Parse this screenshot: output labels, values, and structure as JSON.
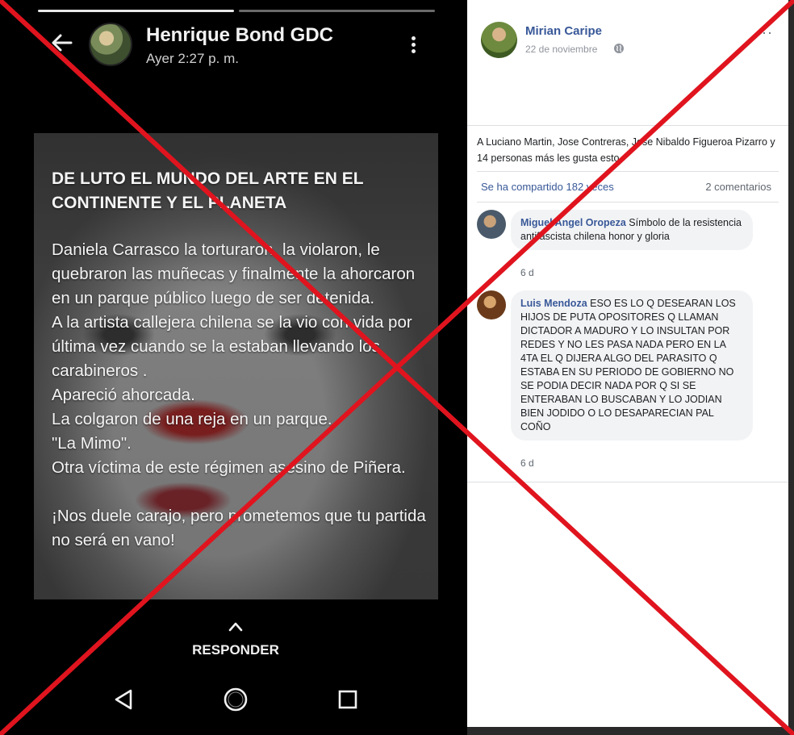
{
  "story": {
    "author": "Henrique Bond GDC",
    "time": "Ayer 2:27 p. m.",
    "heading": "DE LUTO EL MUNDO DEL ARTE EN EL CONTINENTE Y EL PLANETA",
    "body": "Daniela Carrasco la torturaron, la violaron, le quebraron las muñecas y finalmente la ahorcaron en un parque público luego de ser detenida.\nA la artista callejera chilena se la vio con vida por última vez cuando se la estaban llevando los carabineros .\nApareció ahorcada.\nLa colgaron de una reja en un parque.\n\"La Mimo\".\nOtra víctima de este régimen asesino de Piñera.\n\n¡Nos duele carajo, pero  prometemos que tu partida no será en vano!",
    "reply_label": "RESPONDER",
    "progress_active_segment": 1,
    "progress_segments": 2
  },
  "facebook": {
    "author": "Mirian Caripe",
    "date": "22 de noviembre",
    "options_label": "···",
    "likes_text": "A Luciano Martin, Jose Contreras, Jose Nibaldo Figueroa Pizarro y 14 personas más les gusta esto.",
    "shares_text": "Se ha compartido 182 veces",
    "comments_count": "2 comentarios",
    "comments": [
      {
        "author": "Miguel Angel Oropeza",
        "text": "Símbolo de la resistencia antifascista chilena honor y gloria",
        "time": "6 d"
      },
      {
        "author": "Luis Mendoza",
        "text": "ESO ES LO Q DESEARAN LOS HIJOS DE PUTA OPOSITORES Q LLAMAN DICTADOR A MADURO Y LO INSULTAN POR REDES Y NO LES PASA NADA PERO EN LA 4TA EL Q DIJERA ALGO DEL PARASITO Q ESTABA EN SU PERIODO DE GOBIERNO NO SE PODIA DECIR NADA POR Q SI SE ENTERABAN LO BUSCABAN Y LO JODIAN BIEN JODIDO O LO DESAPARECIAN PAL COÑO",
        "time": "6 d"
      }
    ]
  },
  "icons": {
    "back": "back-arrow-icon",
    "more": "more-vertical-icon",
    "reply": "chevron-up-icon",
    "nav_back": "nav-back-triangle-icon",
    "nav_home": "nav-home-circle-icon",
    "nav_recent": "nav-recent-square-icon",
    "privacy": "globe-icon",
    "overlay": "red-x-mark"
  },
  "colors": {
    "fb_link": "#385898",
    "overlay_red": "#e0141e",
    "phone_bg": "#000000"
  }
}
